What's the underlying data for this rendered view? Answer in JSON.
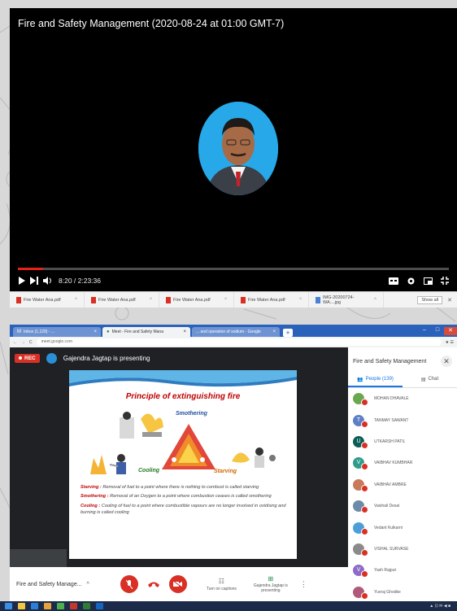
{
  "video": {
    "title": "Fire and Safety Management (2020-08-24 at 01:00 GMT-7)",
    "time_display": "8:20 / 2:23:36",
    "progress_fraction": 0.058
  },
  "downloads": {
    "items": [
      {
        "name": "Fire Water Ana.pdf",
        "type": "pdf"
      },
      {
        "name": "Fire Water Ana.pdf",
        "type": "pdf"
      },
      {
        "name": "Fire Water Ana.pdf",
        "type": "pdf"
      },
      {
        "name": "Fire Water Ana.pdf",
        "type": "pdf"
      },
      {
        "name": "IMG-20200724-WA....jpg",
        "type": "img"
      }
    ],
    "show_all_label": "Show all"
  },
  "browser": {
    "tabs": [
      {
        "label": "Inbox (1,129) - ..."
      },
      {
        "label": "Meet - Fire and Safety Mana"
      },
      {
        "label": "... and operation of sodium - Google"
      }
    ],
    "url": "meet.google.com"
  },
  "meet": {
    "rec_label": "REC",
    "presenter_text": "Gajendra Jagtap is presenting",
    "meeting_name": "Fire and Safety Manage...",
    "captions_label": "Turn on captions",
    "present_label": "Gajendra Jagtap is presenting"
  },
  "slide": {
    "title": "Principle of extinguishing fire",
    "smothering_label": "Smothering",
    "cooling_label": "Cooling",
    "starving_label": "Starving",
    "desc": {
      "starving_term": "Starving :",
      "starving_text": "Removal of fuel to a point where there is nothing to combust is called starving",
      "smothering_term": "Smothering :",
      "smothering_text": "Removal of an Oxygen to a point where combustion ceases is called smothering",
      "cooling_term": "Cooling :",
      "cooling_text": "Cooling of fuel to a point where combustible vapours are no longer involved in oxidising and burning is called cooling"
    }
  },
  "panel": {
    "title": "Fire and Safety Management",
    "people_tab": "People (139)",
    "chat_tab": "Chat",
    "participants": [
      {
        "initial": "",
        "color": "#6aa84f",
        "name": "MOHAN DHAVALE"
      },
      {
        "initial": "T",
        "color": "#5e7fc6",
        "name": "TANMAY SAWANT"
      },
      {
        "initial": "U",
        "color": "#0b5e57",
        "name": "UTKARSH PATIL"
      },
      {
        "initial": "V",
        "color": "#2e9c8a",
        "name": "VAIBHAV KUMBHAR"
      },
      {
        "initial": "",
        "color": "#c97a5a",
        "name": "VAIBHAV AMBRE"
      },
      {
        "initial": "",
        "color": "#6b8ba8",
        "name": "Vaishali Desai"
      },
      {
        "initial": "",
        "color": "#4c9ed9",
        "name": "Vedant Kulkarni"
      },
      {
        "initial": "",
        "color": "#8a8a8a",
        "name": "VISHAL SURVASE"
      },
      {
        "initial": "V",
        "color": "#8e6ac8",
        "name": "Yash Rajput"
      },
      {
        "initial": "",
        "color": "#b05a7a",
        "name": "Yuvraj Ghodke"
      }
    ]
  },
  "colors": {
    "rec": "#d93025",
    "youtube_progress": "#e62117",
    "chrome_tabbar": "#2a61bb",
    "people_tab_active": "#1a73e8"
  }
}
